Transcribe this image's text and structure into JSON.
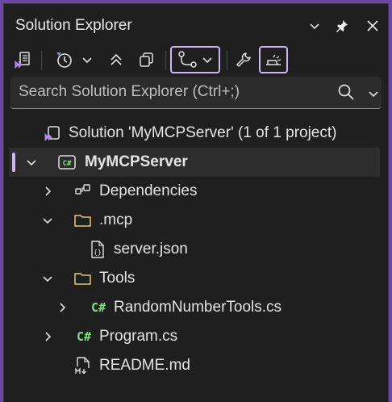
{
  "window": {
    "title": "Solution Explorer"
  },
  "search": {
    "placeholder": "Search Solution Explorer (Ctrl+;)"
  },
  "tree": {
    "solution": "Solution 'MyMCPServer' (1 of 1 project)",
    "project": "MyMCPServer",
    "dependencies": "Dependencies",
    "mcp_folder": ".mcp",
    "server_json": "server.json",
    "tools_folder": "Tools",
    "random_tools": "RandomNumberTools.cs",
    "program": "Program.cs",
    "readme": "README.md"
  },
  "icons": {
    "csharp_glyph": "C#",
    "csharp_small": "C#"
  },
  "colors": {
    "accent": "#c9b6f2",
    "folder": "#e8c77a",
    "csharp": "#7fe07f",
    "vs_purple": "#8e6cd6"
  }
}
